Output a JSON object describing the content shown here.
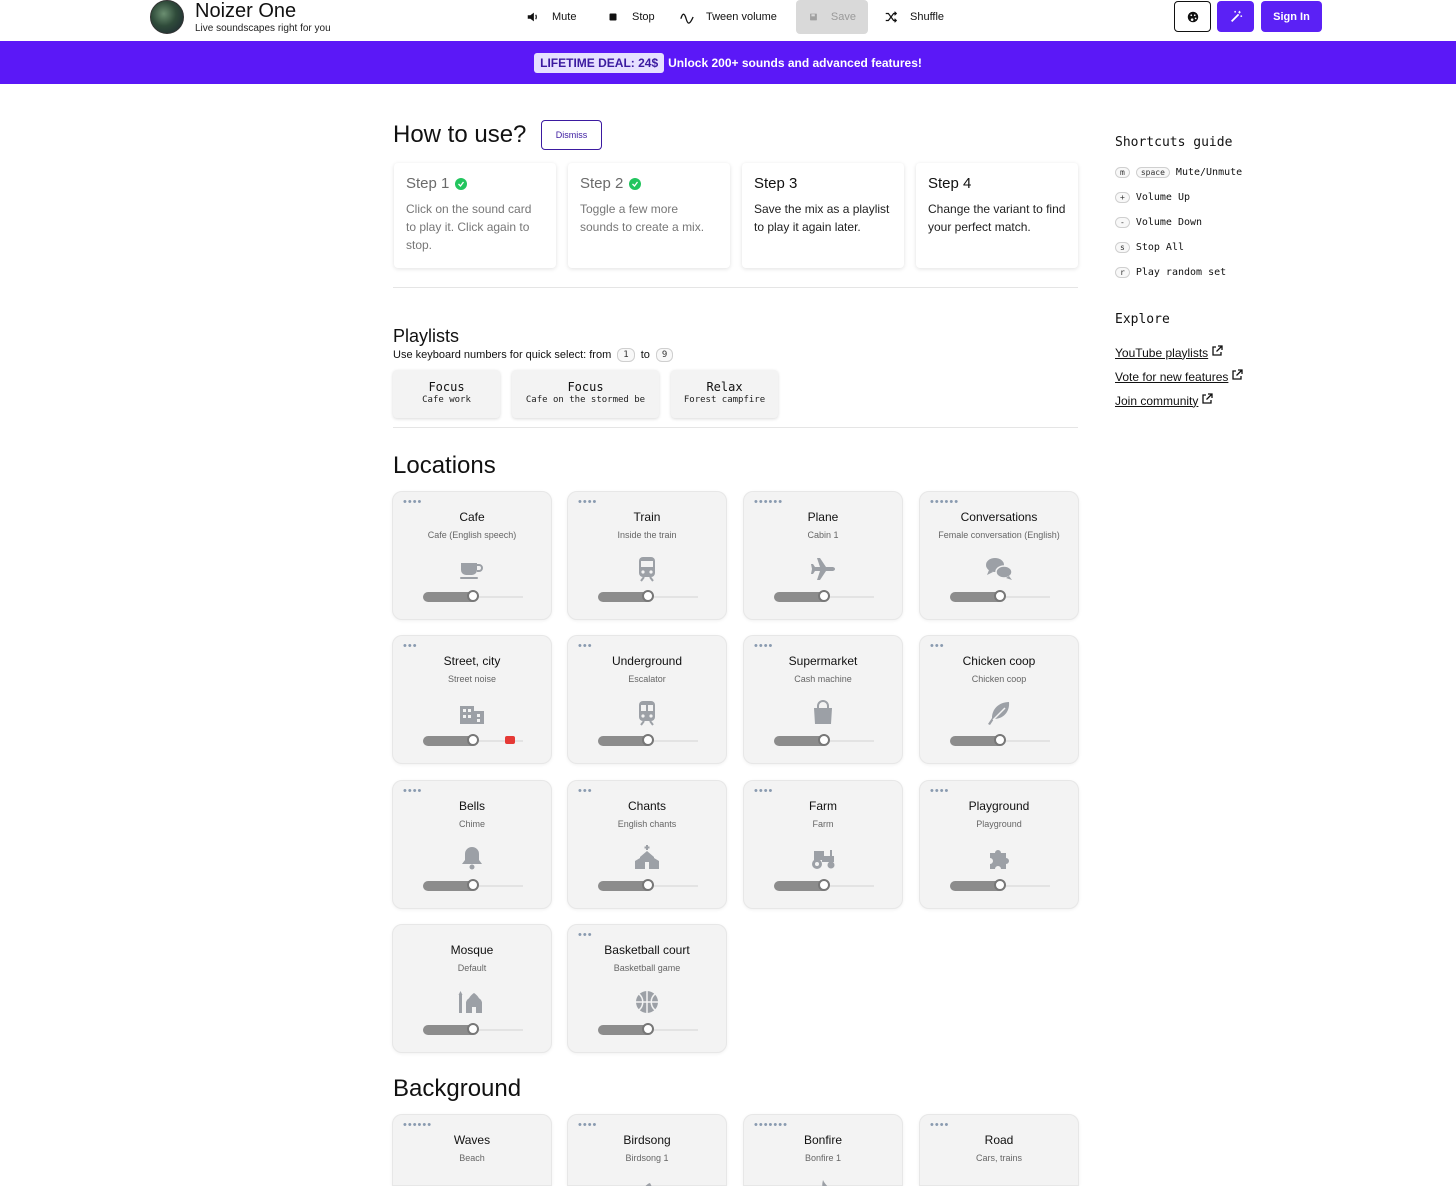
{
  "header": {
    "brand_title": "Noizer One",
    "brand_subtitle": "Live soundscapes right for you",
    "toolbar": {
      "mute": "Mute",
      "stop": "Stop",
      "tween": "Tween volume",
      "save": "Save",
      "shuffle": "Shuffle"
    },
    "sign_in": "Sign In",
    "accent": "#5b21f5"
  },
  "banner": {
    "deal": "LIFETIME DEAL: 24$",
    "text": "Unlock 200+ sounds and advanced features!"
  },
  "howto": {
    "title": "How to use?",
    "dismiss": "Dismiss",
    "steps": [
      {
        "title": "Step 1",
        "desc": "Click on the sound card to play it. Click again to stop.",
        "done": true
      },
      {
        "title": "Step 2",
        "desc": "Toggle a few more sounds to create a mix.",
        "done": true
      },
      {
        "title": "Step 3",
        "desc": "Save the mix as a playlist to play it again later.",
        "done": false
      },
      {
        "title": "Step 4",
        "desc": "Change the variant to find your perfect match.",
        "done": false
      }
    ]
  },
  "playlists": {
    "title": "Playlists",
    "hint": "Use keyboard numbers for quick select: from",
    "hint_to": "to",
    "key_from": "1",
    "key_to": "9",
    "items": [
      {
        "name": "Focus",
        "sub": "Cafe work"
      },
      {
        "name": "Focus",
        "sub": "Cafe on the stormed be"
      },
      {
        "name": "Relax",
        "sub": "Forest campfire"
      }
    ]
  },
  "locations": {
    "title": "Locations",
    "cards": [
      {
        "title": "Cafe",
        "sub": "Cafe (English speech)",
        "dots": "••••",
        "icon": "coffee-icon",
        "volume": 0.5
      },
      {
        "title": "Train",
        "sub": "Inside the train",
        "dots": "••••",
        "icon": "train-icon",
        "volume": 0.5
      },
      {
        "title": "Plane",
        "sub": "Cabin 1",
        "dots": "••••••",
        "icon": "plane-icon",
        "volume": 0.5
      },
      {
        "title": "Conversations",
        "sub": "Female conversation (English)",
        "dots": "••••••",
        "icon": "chat-icon",
        "volume": 0.5
      },
      {
        "title": "Street, city",
        "sub": "Street noise",
        "dots": "•••",
        "icon": "city-icon",
        "volume": 0.5
      },
      {
        "title": "Underground",
        "sub": "Escalator",
        "dots": "•••",
        "icon": "subway-icon",
        "volume": 0.5
      },
      {
        "title": "Supermarket",
        "sub": "Cash machine",
        "dots": "••••",
        "icon": "bag-icon",
        "volume": 0.5
      },
      {
        "title": "Chicken coop",
        "sub": "Chicken coop",
        "dots": "•••",
        "icon": "feather-icon",
        "volume": 0.5
      },
      {
        "title": "Bells",
        "sub": "Chime",
        "dots": "••••",
        "icon": "bell-icon",
        "volume": 0.5
      },
      {
        "title": "Chants",
        "sub": "English chants",
        "dots": "•••",
        "icon": "church-icon",
        "volume": 0.5
      },
      {
        "title": "Farm",
        "sub": "Farm",
        "dots": "••••",
        "icon": "tractor-icon",
        "volume": 0.5
      },
      {
        "title": "Playground",
        "sub": "Playground",
        "dots": "••••",
        "icon": "puzzle-icon",
        "volume": 0.5
      },
      {
        "title": "Mosque",
        "sub": "Default",
        "dots": "",
        "icon": "mosque-icon",
        "volume": 0.5
      },
      {
        "title": "Basketball court",
        "sub": "Basketball game",
        "dots": "•••",
        "icon": "basketball-icon",
        "volume": 0.5
      }
    ]
  },
  "background": {
    "title": "Background",
    "cards": [
      {
        "title": "Waves",
        "sub": "Beach",
        "dots": "••••••",
        "icon": "waves-icon"
      },
      {
        "title": "Birdsong",
        "sub": "Birdsong 1",
        "dots": "••••",
        "icon": "bird-icon"
      },
      {
        "title": "Bonfire",
        "sub": "Bonfire 1",
        "dots": "•••••••",
        "icon": "fire-icon"
      },
      {
        "title": "Road",
        "sub": "Cars, trains",
        "dots": "••••",
        "icon": "car-icon"
      }
    ]
  },
  "shortcuts": {
    "title": "Shortcuts guide",
    "items": [
      {
        "keys": [
          "m",
          "space"
        ],
        "label": "Mute/Unmute"
      },
      {
        "keys": [
          "+"
        ],
        "label": "Volume Up"
      },
      {
        "keys": [
          "-"
        ],
        "label": "Volume Down"
      },
      {
        "keys": [
          "s"
        ],
        "label": "Stop All"
      },
      {
        "keys": [
          "r"
        ],
        "label": "Play random set"
      }
    ]
  },
  "explore": {
    "title": "Explore",
    "links": [
      "YouTube playlists",
      "Vote for new features",
      "Join community"
    ]
  }
}
